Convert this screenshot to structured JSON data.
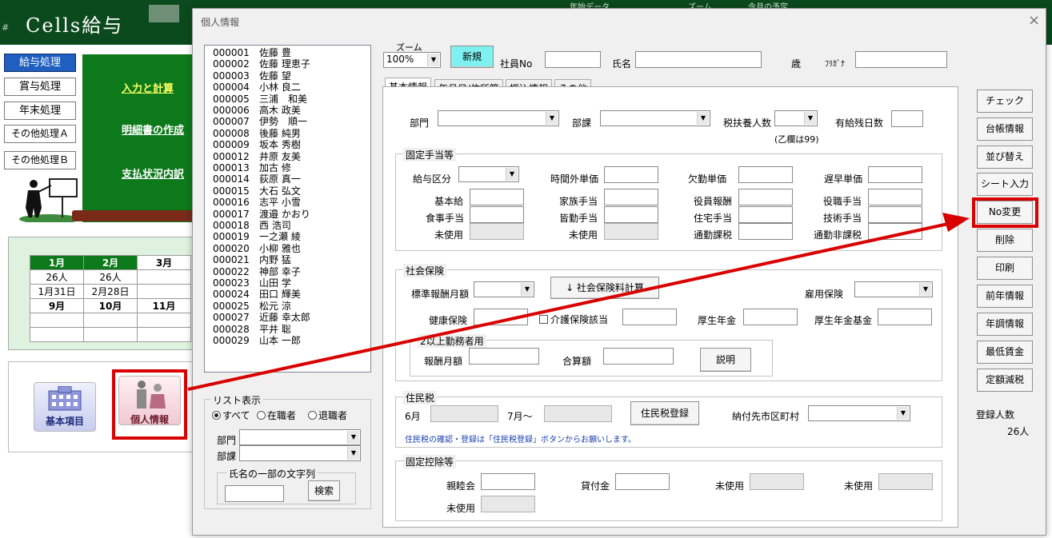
{
  "app": {
    "title": "Cells給与",
    "hash": "#",
    "header_small": [
      "年始データ",
      "ズーム",
      "今月の予定"
    ],
    "side_menu": [
      "給与処理",
      "賞与処理",
      "年末処理",
      "その他処理Ａ",
      "その他処理Ｂ"
    ],
    "green_links": [
      "入力と計算",
      "明細書の作成",
      "支払状況内訳"
    ],
    "calendar": {
      "months_row1": [
        "1月",
        "2月",
        "3月"
      ],
      "counts_row1": [
        "26人",
        "26人",
        ""
      ],
      "dates_row1": [
        "1月31日",
        "2月28日",
        ""
      ],
      "months_row2": [
        "9月",
        "10月",
        "11月"
      ]
    },
    "bottom_buttons": {
      "basic_label": "基本項目",
      "person_label": "個人情報"
    }
  },
  "dialog": {
    "title": "個人情報",
    "close": "×",
    "employees": [
      {
        "no": "000001",
        "name": "佐藤 豊"
      },
      {
        "no": "000002",
        "name": "佐藤 理恵子"
      },
      {
        "no": "000003",
        "name": "佐藤 望"
      },
      {
        "no": "000004",
        "name": "小林 良二"
      },
      {
        "no": "000005",
        "name": "三浦　和美"
      },
      {
        "no": "000006",
        "name": "高木 政美"
      },
      {
        "no": "000007",
        "name": "伊勢　順一"
      },
      {
        "no": "000008",
        "name": "後藤 純男"
      },
      {
        "no": "000009",
        "name": "坂本 秀樹"
      },
      {
        "no": "000012",
        "name": "井原 友美"
      },
      {
        "no": "000013",
        "name": "加古 修"
      },
      {
        "no": "000014",
        "name": "荻原 真一"
      },
      {
        "no": "000015",
        "name": "大石 弘文"
      },
      {
        "no": "000016",
        "name": "志平 小雪"
      },
      {
        "no": "000017",
        "name": "渡邉 かおり"
      },
      {
        "no": "000018",
        "name": "西 浩司"
      },
      {
        "no": "000019",
        "name": "一之瀬 綾"
      },
      {
        "no": "000020",
        "name": "小柳 雅也"
      },
      {
        "no": "000021",
        "name": "内野 猛"
      },
      {
        "no": "000022",
        "name": "神部 幸子"
      },
      {
        "no": "000023",
        "name": "山田 学"
      },
      {
        "no": "000024",
        "name": "田口 輝美"
      },
      {
        "no": "000025",
        "name": "松元 涼"
      },
      {
        "no": "000027",
        "name": "近藤 幸太郎"
      },
      {
        "no": "000028",
        "name": "平井 聡"
      },
      {
        "no": "000029",
        "name": "山本 一郎"
      }
    ],
    "list_filter": {
      "legend": "リスト表示",
      "all": "すべて",
      "active": "在職者",
      "retired": "退職者",
      "dept": "部門",
      "section": "部課",
      "name_search_legend": "氏名の一部の文字列",
      "search_button": "検索"
    },
    "top": {
      "zoom_label": "ズーム",
      "zoom_value": "100%",
      "new_button": "新規",
      "emp_no_label": "社員No",
      "name_label": "氏名",
      "age_label": "歳",
      "kana_label": "ﾌﾘｶﾞﾅ"
    },
    "tabs": [
      "基本情報",
      "年月日/住所等",
      "振込情報",
      "その他"
    ],
    "basic": {
      "dept": "部門",
      "section": "部課",
      "dependents": "税扶養人数",
      "paid_leave": "有給残日数",
      "otsu_note": "(乙欄は99)",
      "fixed_legend": "固定手当等",
      "salary_type": "給与区分",
      "overtime_rate": "時間外単価",
      "absence_rate": "欠勤単価",
      "late_rate": "遅早単価",
      "base_pay": "基本給",
      "family_allow": "家族手当",
      "officer_pay": "役員報酬",
      "position_allow": "役職手当",
      "meal_allow": "食事手当",
      "attendance_allow": "皆勤手当",
      "housing_allow": "住宅手当",
      "skill_allow": "技術手当",
      "unused1": "未使用",
      "unused2": "未使用",
      "commute_taxable": "通勤課税",
      "commute_nontax": "通勤非課税",
      "social_legend": "社会保険",
      "std_monthly": "標準報酬月額",
      "calc_button": "↓ 社会保険料計算",
      "employment_ins": "雇用保険",
      "health_ins": "健康保険",
      "care_ins": "介護保険該当",
      "pension": "厚生年金",
      "pension_fund": "厚生年金基金",
      "multi_legend": "2以上勤務者用",
      "pay_monthly": "報酬月額",
      "total": "合算額",
      "explain_button": "説明",
      "resident_legend": "住民税",
      "june": "6月",
      "july": "7月～",
      "resident_register": "住民税登録",
      "city": "納付先市区町村",
      "resident_note": "住民税の確認・登録は「住民税登録」ボタンからお願いします。",
      "deduct_legend": "固定控除等",
      "social_club": "親睦会",
      "loan": "貸付金",
      "unused3": "未使用",
      "unused4": "未使用",
      "unused5": "未使用"
    },
    "side_actions": [
      "チェック",
      "台帳情報",
      "並び替え",
      "シート入力",
      "No変更",
      "削除",
      "印刷",
      "前年情報",
      "年調情報",
      "最低賃金",
      "定額減税"
    ],
    "registered_label": "登録人数",
    "registered_count": "26人"
  },
  "colors": {
    "highlight": "#d90000",
    "header_green": "#0b4a1c",
    "panel_green": "#0c7a1a",
    "new_button": "#7ff0f0"
  }
}
